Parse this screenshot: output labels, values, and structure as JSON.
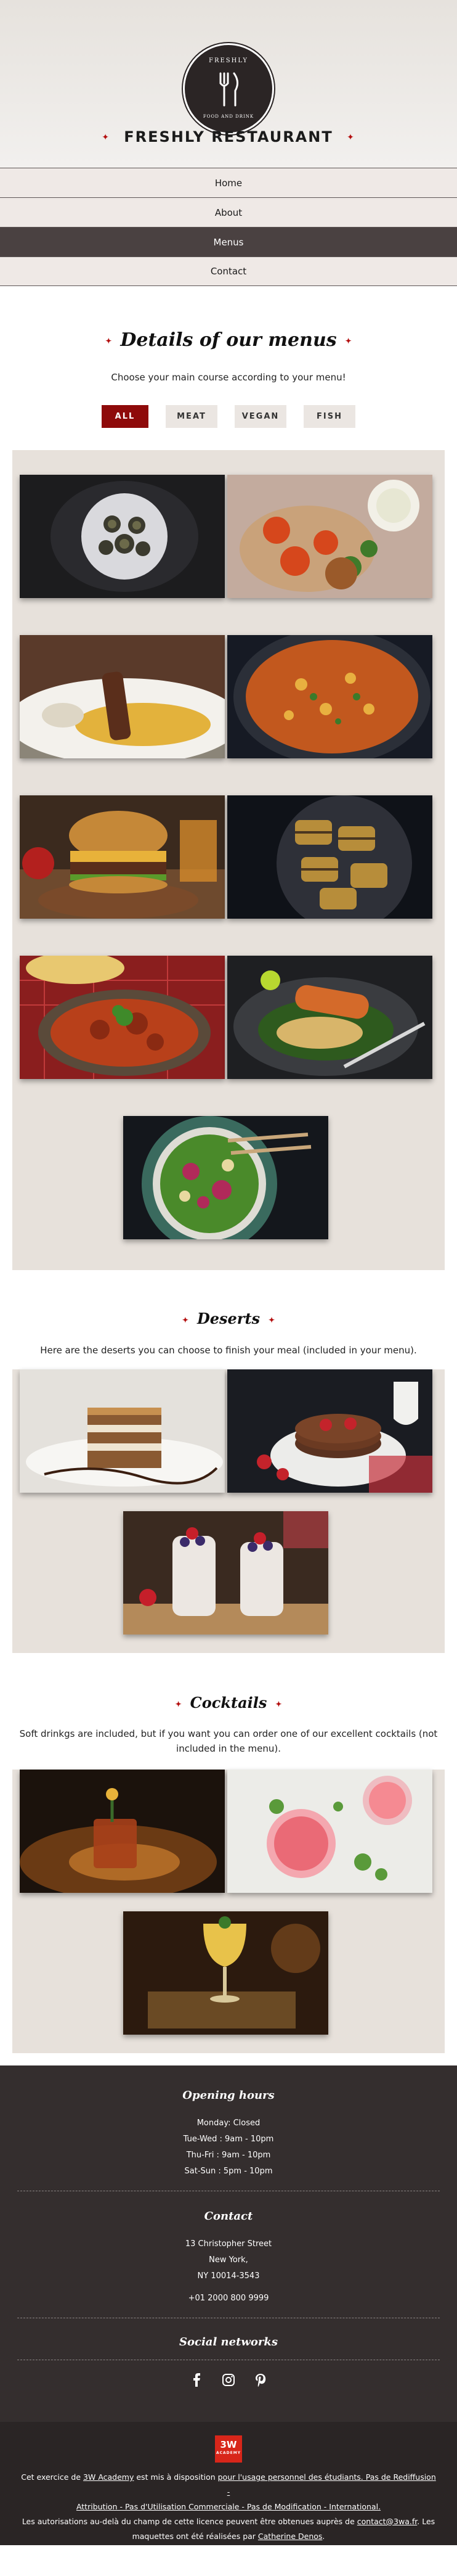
{
  "header": {
    "logo_top": "FRESHLY",
    "logo_bottom": "FOOD AND DRINK",
    "title": "FRESHLY RESTAURANT",
    "star": "✦"
  },
  "nav": {
    "items": [
      {
        "label": "Home"
      },
      {
        "label": "About"
      },
      {
        "label": "Menus"
      },
      {
        "label": "Contact"
      }
    ],
    "active": "Menus"
  },
  "menus": {
    "title": "Details of our menus",
    "subtitle": "Choose your main course according to your menu!",
    "filters": [
      {
        "label": "ALL"
      },
      {
        "label": "MEAT"
      },
      {
        "label": "VEGAN"
      },
      {
        "label": "FISH"
      }
    ],
    "active_filter": "ALL"
  },
  "deserts": {
    "title": "Deserts",
    "subtitle": "Here are the deserts you can choose to finish your meal (included in your menu)."
  },
  "cocktails": {
    "title": "Cocktails",
    "subtitle_line1": "Soft drinkgs are included, but if you want you can order one of our excellent cocktails (not",
    "subtitle_line2": "included in the menu)."
  },
  "footer": {
    "hours_title": "Opening hours",
    "hours": [
      "Monday: Closed",
      "Tue-Wed : 9am - 10pm",
      "Thu-Fri : 9am - 10pm",
      "Sat-Sun : 5pm - 10pm"
    ],
    "contact_title": "Contact",
    "address": [
      "13 Christopher Street",
      "New York,",
      "NY 10014-3543"
    ],
    "phone": "+01 2000 800 9999",
    "social_title": "Social networks",
    "social_icons": [
      "facebook-icon",
      "instagram-icon",
      "pinterest-icon"
    ]
  },
  "credits": {
    "badge": "3W",
    "badge_sub": "ACADEMY",
    "line1_a": "Cet exercice de ",
    "line1_link1": "3W Academy",
    "line1_b": " est mis à disposition ",
    "line1_link2": "pour l'usage personnel des étudiants. Pas de Rediffusion -",
    "line2": "Attribution - Pas d'Utilisation Commerciale - Pas de Modification - International.",
    "line3_a": "Les autorisations au-delà du champ de cette licence peuvent être obtenues auprès de ",
    "line3_link": "contact@3wa.fr",
    "line3_b": ". Les",
    "line4_a": "maquettes ont été réalisées par ",
    "line4_link": "Catherine Denos",
    "line4_b": "."
  },
  "colors": {
    "accent_red": "#8e0a0a",
    "nav_active": "#4a4141",
    "panel_bg": "#e7e1db",
    "footer_bg": "#342e2e"
  }
}
